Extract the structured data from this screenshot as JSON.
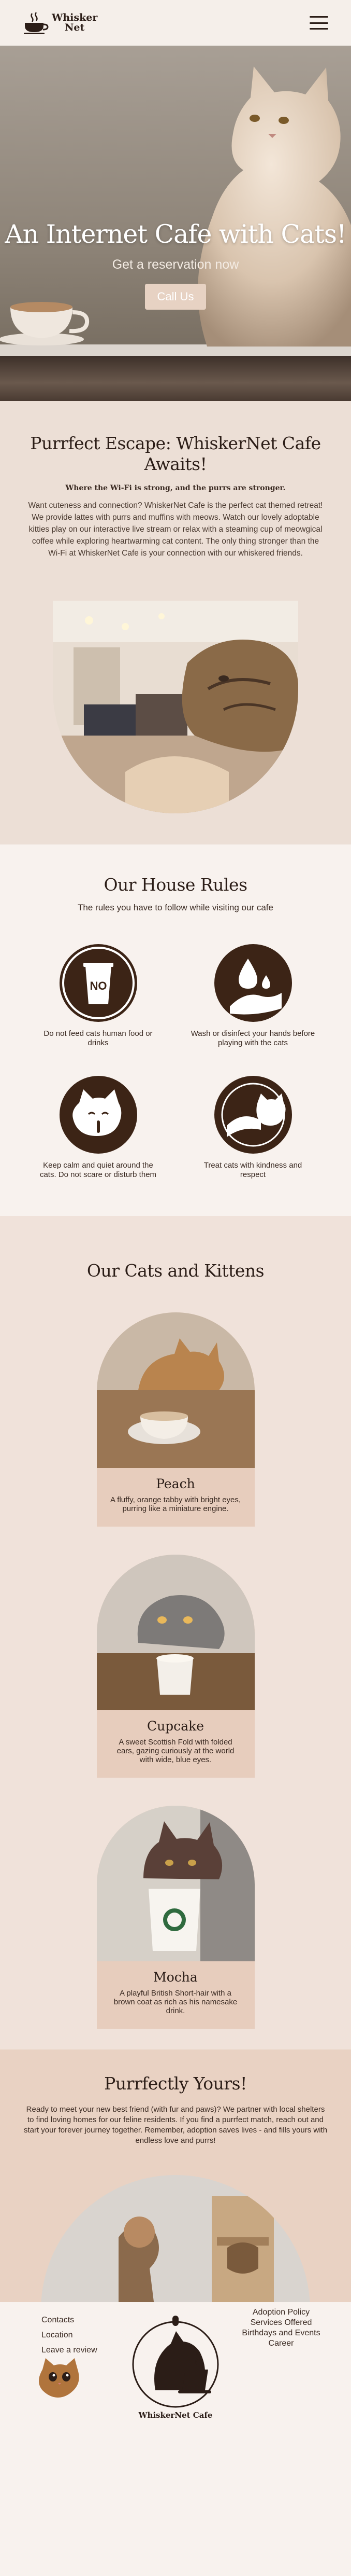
{
  "header": {
    "logo_text_line1": "Whisker",
    "logo_text_line2": "Net",
    "menu_icon": "hamburger-menu-icon"
  },
  "hero": {
    "title": "An Internet Cafe with Cats!",
    "subtitle": "Get a reservation now",
    "cta_label": "Call Us"
  },
  "intro": {
    "title_line1": "Purrfect Escape: WhiskerNet Cafe",
    "title_line2": "Awaits!",
    "tagline": "Where the Wi-Fi is strong, and the purrs are stronger.",
    "body": "Want cuteness and connection? WhiskerNet Cafe is the perfect cat themed retreat! We provide lattes with purrs and muffins with meows. Watch our lovely adoptable kitties play on our interactive live stream or relax with a steaming cup of meowgical coffee while exploring heartwarming cat content. The only thing stronger than the Wi-Fi at WhiskerNet Cafe is your connection with our whiskered friends."
  },
  "rules": {
    "title": "Our House Rules",
    "subtitle": "The rules you have to follow while visiting our cafe",
    "items": [
      {
        "icon": "no-food-cup-icon",
        "cup_label": "NO",
        "text": "Do not feed cats human food or drinks"
      },
      {
        "icon": "wash-hands-icon",
        "text": "Wash or disinfect your hands before playing with the cats"
      },
      {
        "icon": "quiet-cat-icon",
        "text": "Keep calm and quiet around the cats. Do not scare or disturb them"
      },
      {
        "icon": "gentle-hand-cat-icon",
        "text": "Treat cats with kindness and respect"
      }
    ]
  },
  "cats": {
    "title": "Our Cats and Kittens",
    "items": [
      {
        "name": "Peach",
        "desc": "A fluffy, orange tabby with bright eyes, purring like a miniature engine."
      },
      {
        "name": "Cupcake",
        "desc": "A sweet Scottish Fold with folded ears, gazing curiously at the world with wide, blue eyes."
      },
      {
        "name": "Mocha",
        "desc": "A playful British Short-hair with a brown coat as rich as his namesake drink."
      }
    ]
  },
  "adopt": {
    "title": "Purrfectly Yours!",
    "body": "Ready to meet your new best friend (with fur and paws)? We partner with local shelters to find loving homes for our feline residents. If you find a purrfect match, reach out and start your forever journey together. Remember, adoption saves lives - and fills yours with endless love and purrs!"
  },
  "footer": {
    "left_links": [
      "Contacts",
      "Location",
      "Leave a review"
    ],
    "logo_text": "WhiskerNet Cafe",
    "right_links": [
      "Adoption Policy",
      "Services Offered",
      "Birthdays and Events",
      "Career"
    ]
  },
  "colors": {
    "accent_dark": "#3c2416",
    "cta_bg": "#e7d2c3",
    "section_peach": "#e9d2c3",
    "card_bg": "#e7cdbd"
  }
}
